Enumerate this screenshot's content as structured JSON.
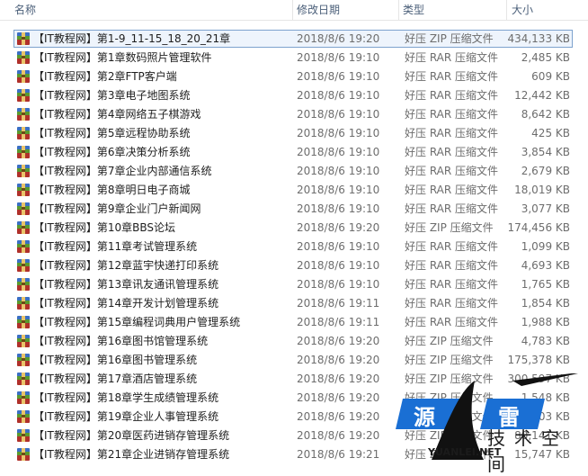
{
  "columns": {
    "name": "名称",
    "date": "修改日期",
    "type": "类型",
    "size": "大小"
  },
  "files": [
    {
      "name": "【IT教程网】第1-9_11-15_18_20_21章",
      "date": "2018/8/6 19:20",
      "type": "好压 ZIP 压缩文件",
      "size": "434,133 KB",
      "selected": true
    },
    {
      "name": "【IT教程网】第1章数码照片管理软件",
      "date": "2018/8/6 19:10",
      "type": "好压 RAR 压缩文件",
      "size": "2,485 KB"
    },
    {
      "name": "【IT教程网】第2章FTP客户端",
      "date": "2018/8/6 19:10",
      "type": "好压 RAR 压缩文件",
      "size": "609 KB"
    },
    {
      "name": "【IT教程网】第3章电子地图系统",
      "date": "2018/8/6 19:10",
      "type": "好压 RAR 压缩文件",
      "size": "12,442 KB"
    },
    {
      "name": "【IT教程网】第4章网络五子棋游戏",
      "date": "2018/8/6 19:10",
      "type": "好压 RAR 压缩文件",
      "size": "8,642 KB"
    },
    {
      "name": "【IT教程网】第5章远程协助系统",
      "date": "2018/8/6 19:10",
      "type": "好压 RAR 压缩文件",
      "size": "425 KB"
    },
    {
      "name": "【IT教程网】第6章决策分析系统",
      "date": "2018/8/6 19:10",
      "type": "好压 RAR 压缩文件",
      "size": "3,854 KB"
    },
    {
      "name": "【IT教程网】第7章企业内部通信系统",
      "date": "2018/8/6 19:10",
      "type": "好压 RAR 压缩文件",
      "size": "2,679 KB"
    },
    {
      "name": "【IT教程网】第8章明日电子商城",
      "date": "2018/8/6 19:10",
      "type": "好压 RAR 压缩文件",
      "size": "18,019 KB"
    },
    {
      "name": "【IT教程网】第9章企业门户新闻网",
      "date": "2018/8/6 19:10",
      "type": "好压 RAR 压缩文件",
      "size": "3,077 KB"
    },
    {
      "name": "【IT教程网】第10章BBS论坛",
      "date": "2018/8/6 19:20",
      "type": "好压 ZIP 压缩文件",
      "size": "174,456 KB"
    },
    {
      "name": "【IT教程网】第11章考试管理系统",
      "date": "2018/8/6 19:10",
      "type": "好压 RAR 压缩文件",
      "size": "1,099 KB"
    },
    {
      "name": "【IT教程网】第12章蓝宇快递打印系统",
      "date": "2018/8/6 19:10",
      "type": "好压 RAR 压缩文件",
      "size": "4,693 KB"
    },
    {
      "name": "【IT教程网】第13章讯友通讯管理系统",
      "date": "2018/8/6 19:10",
      "type": "好压 RAR 压缩文件",
      "size": "1,765 KB"
    },
    {
      "name": "【IT教程网】第14章开发计划管理系统",
      "date": "2018/8/6 19:11",
      "type": "好压 RAR 压缩文件",
      "size": "1,854 KB"
    },
    {
      "name": "【IT教程网】第15章编程词典用户管理系统",
      "date": "2018/8/6 19:11",
      "type": "好压 RAR 压缩文件",
      "size": "1,988 KB"
    },
    {
      "name": "【IT教程网】第16章图书馆管理系统",
      "date": "2018/8/6 19:20",
      "type": "好压 ZIP 压缩文件",
      "size": "4,783 KB"
    },
    {
      "name": "【IT教程网】第16章图书管理系统",
      "date": "2018/8/6 19:20",
      "type": "好压 ZIP 压缩文件",
      "size": "175,378 KB"
    },
    {
      "name": "【IT教程网】第17章酒店管理系统",
      "date": "2018/8/6 19:20",
      "type": "好压 ZIP 压缩文件",
      "size": "300,597 KB"
    },
    {
      "name": "【IT教程网】第18章学生成绩管理系统",
      "date": "2018/8/6 19:20",
      "type": "好压 ZIP 压缩文件",
      "size": "1,548 KB"
    },
    {
      "name": "【IT教程网】第19章企业人事管理系统",
      "date": "2018/8/6 19:20",
      "type": "好压 ZIP 压缩文件",
      "size": "38,403 KB"
    },
    {
      "name": "【IT教程网】第20章医药进销存管理系统",
      "date": "2018/8/6 19:20",
      "type": "好压 ZIP 压缩文件",
      "size": "80,141 KB"
    },
    {
      "name": "【IT教程网】第21章企业进销存管理系统",
      "date": "2018/8/6 19:21",
      "type": "好压 ZIP 压缩文件",
      "size": "15,747 KB"
    }
  ],
  "watermark": {
    "char1": "源",
    "char2": "雷",
    "tech": "技术空间",
    "url": "YUANLEI.NET"
  },
  "colors": {
    "header_text": "#4c607a",
    "selection_border": "#7da2ce",
    "selection_fill": "#eef4fc",
    "watermark_blue": "#1a6fd4"
  },
  "icons": {
    "file": "archive-icon"
  }
}
